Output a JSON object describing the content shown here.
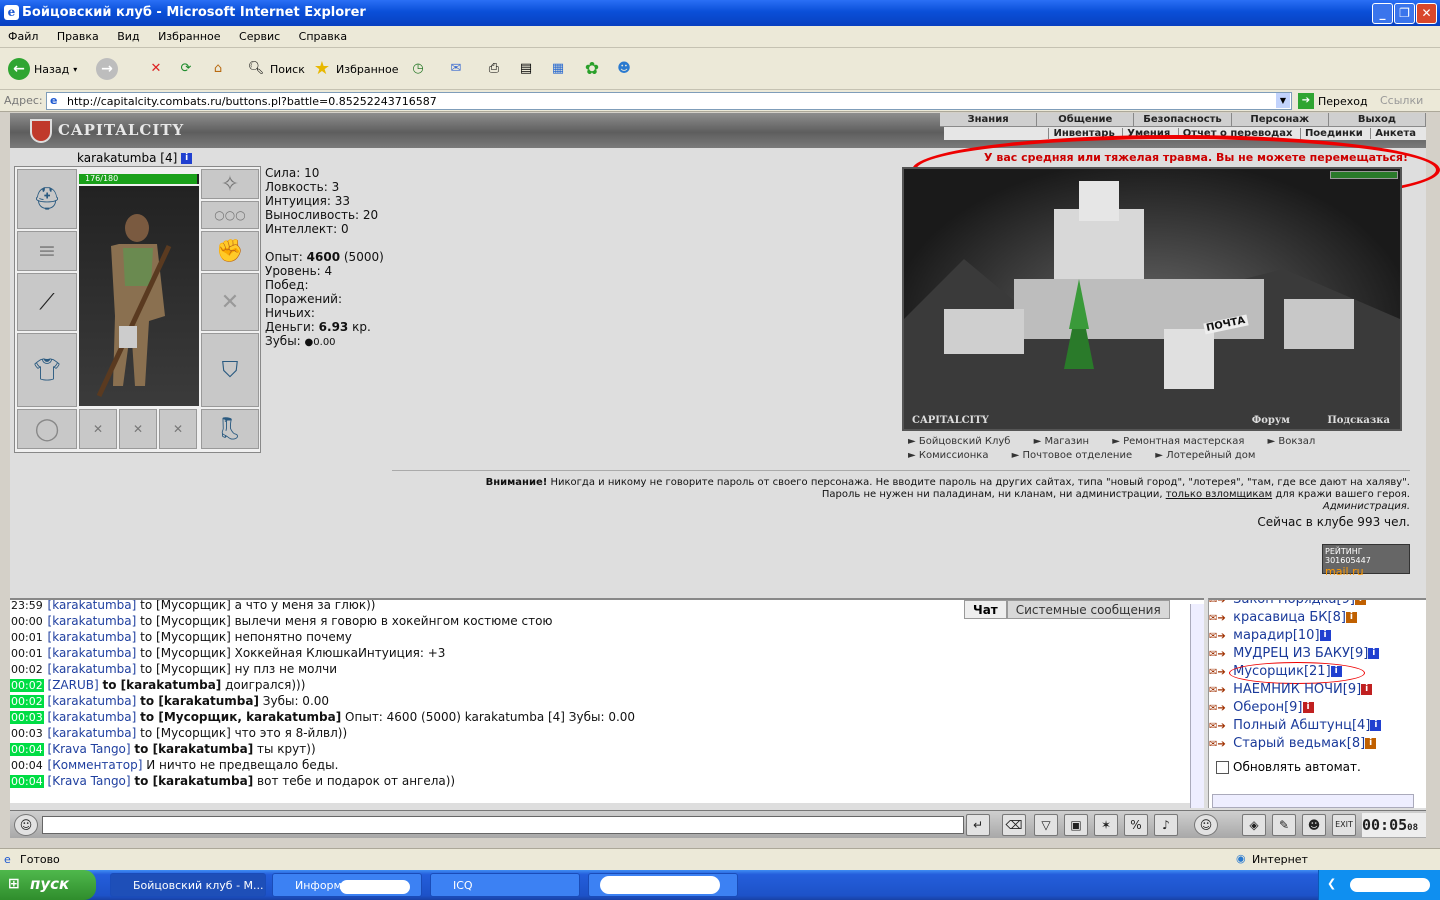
{
  "window": {
    "title": "Бойцовский клуб - Microsoft Internet Explorer"
  },
  "menu": [
    "Файл",
    "Правка",
    "Вид",
    "Избранное",
    "Сервис",
    "Справка"
  ],
  "toolbar": {
    "back": "Назад",
    "search": "Поиск",
    "favorites": "Избранное"
  },
  "address": {
    "label": "Адрес:",
    "url": "http://capitalcity.combats.ru/buttons.pl?battle=0.85252243716587",
    "go": "Переход",
    "links": "Ссылки"
  },
  "game": {
    "logo": "CAPITALCITY",
    "nav_main": [
      "Знания",
      "Общение",
      "Безопасность",
      "Персонаж",
      "Выход"
    ],
    "nav_sub": [
      "Инвентарь",
      "Умения",
      "Отчет о переводах",
      "Поединки",
      "Анкета"
    ],
    "char": {
      "name": "karakatumba",
      "level": "[4]",
      "hp": "176/180",
      "hp_fraction": 0.978
    },
    "stats": [
      {
        "label": "Сила:",
        "value": "10"
      },
      {
        "label": "Ловкость:",
        "value": "3"
      },
      {
        "label": "Интуиция:",
        "value": "33"
      },
      {
        "label": "Выносливость:",
        "value": "20"
      },
      {
        "label": "Интеллект:",
        "value": "0"
      }
    ],
    "info": {
      "exp_label": "Опыт:",
      "exp": "4600",
      "exp_next": "(5000)",
      "level_label": "Уровень:",
      "level": "4",
      "wins_label": "Побед:",
      "wins": "",
      "losses_label": "Поражений:",
      "losses": "",
      "draws_label": "Ничьих:",
      "draws": "",
      "money_label": "Деньги:",
      "money": "6.93",
      "money_unit": "кр.",
      "teeth_label": "Зубы:",
      "teeth": "0.00"
    },
    "injury": "У вас средняя или тяжелая травма. Вы не можете перемещаться!",
    "scene": {
      "label": "CAPITALCITY",
      "forum": "Форум",
      "hint": "Подсказка",
      "post_sign": "ПОЧТА"
    },
    "links_row1": [
      "Бойцовский Клуб",
      "Магазин",
      "Ремонтная мастерская",
      "Вокзал"
    ],
    "links_row2": [
      "Комиссионка",
      "Почтовое отделение",
      "Лотерейный дом"
    ],
    "warning": {
      "bold": "Внимание!",
      "text1": "Никогда и никому не говорите пароль от своего персонажа. Не вводите пароль на других сайтах, типа \"новый город\", \"лотерея\", \"там, где все дают на халяву\".",
      "text2_a": "Пароль не нужен ни паладинам, ни кланам, ни администрации,",
      "text2_link": "только взломщикам",
      "text2_b": "для кражи вашего героя.",
      "sign": "Администрация."
    },
    "online": "Сейчас в клубе 993 чел.",
    "rating": {
      "top": "РЕЙТИНГ 301605447",
      "bottom": "mail.ru"
    }
  },
  "chat": {
    "tabs": [
      "Чат",
      "Системные сообщения"
    ],
    "lines": [
      {
        "t": "23:59",
        "g": false,
        "from": "[karakatumba]",
        "to": "to [Мусорщик]",
        "msg": "а что у меня за глюк))",
        "bold": false
      },
      {
        "t": "00:00",
        "g": false,
        "from": "[karakatumba]",
        "to": "to [Мусорщик]",
        "msg": "вылечи меня я говорю в хокейнгом костюме стою",
        "bold": false
      },
      {
        "t": "00:01",
        "g": false,
        "from": "[karakatumba]",
        "to": "to [Мусорщик]",
        "msg": "непонятно почему",
        "bold": false
      },
      {
        "t": "00:01",
        "g": false,
        "from": "[karakatumba]",
        "to": "to [Мусорщик]",
        "msg": "Хоккейная КлюшкаИнтуиция: +3",
        "bold": false
      },
      {
        "t": "00:02",
        "g": false,
        "from": "[karakatumba]",
        "to": "to [Мусорщик]",
        "msg": "ну плз не молчи",
        "bold": false
      },
      {
        "t": "00:02",
        "g": true,
        "from": "[ZARUB]",
        "to": "to [karakatumba]",
        "msg": "доигрался)))",
        "bold": true
      },
      {
        "t": "00:02",
        "g": true,
        "from": "[karakatumba]",
        "to": "to [karakatumba]",
        "msg": "Зубы: 0.00",
        "bold": true
      },
      {
        "t": "00:03",
        "g": true,
        "from": "[karakatumba]",
        "to": "to [Мусорщик, karakatumba]",
        "msg": "Опыт: 4600 (5000) karakatumba [4] Зубы: 0.00",
        "bold": true
      },
      {
        "t": "00:03",
        "g": false,
        "from": "[karakatumba]",
        "to": "to [Мусорщик]",
        "msg": "что это я 8-йлвл))",
        "bold": false
      },
      {
        "t": "00:04",
        "g": true,
        "from": "[Krava Tango]",
        "to": "to [karakatumba]",
        "msg": "ты крут))",
        "bold": true
      },
      {
        "t": "00:04",
        "g": false,
        "from": "[Комментатор]",
        "to": "",
        "msg": "И ничто не предвещало беды.",
        "bold": false
      },
      {
        "t": "00:04",
        "g": true,
        "from": "[Krava Tango]",
        "to": "to [karakatumba]",
        "msg": "вот тебе и подарок от ангела))",
        "bold": true
      }
    ]
  },
  "users": [
    {
      "name": "Закон Порядка",
      "lvl": "[9]",
      "color": "#c06000"
    },
    {
      "name": "красавица БК",
      "lvl": "[8]",
      "color": "#c06000"
    },
    {
      "name": "марадир",
      "lvl": "[10]",
      "color": "#2040d0"
    },
    {
      "name": "МУДРЕЦ ИЗ БАКУ",
      "lvl": "[9]",
      "color": "#2040d0"
    },
    {
      "name": "Мусорщик",
      "lvl": "[21]",
      "color": "#2040d0"
    },
    {
      "name": "НАЕМНИК НОЧИ",
      "lvl": "[9]",
      "color": "#c02020"
    },
    {
      "name": "Оберон",
      "lvl": "[9]",
      "color": "#c02020"
    },
    {
      "name": "Полный Абштунц",
      "lvl": "[4]",
      "color": "#2040d0"
    },
    {
      "name": "Старый ведьмак",
      "lvl": "[8]",
      "color": "#c06000"
    }
  ],
  "auto_refresh": "Обновлять автомат.",
  "clock": {
    "time": "00:05",
    "sec": "08",
    "exit": "EXIT"
  },
  "statusbar": {
    "left": "Готово",
    "right": "Интернет"
  },
  "taskbar": {
    "start": "пуск",
    "tasks": [
      "Бойцовский клуб - М...",
      "Информация о...",
      "ICQ"
    ]
  }
}
